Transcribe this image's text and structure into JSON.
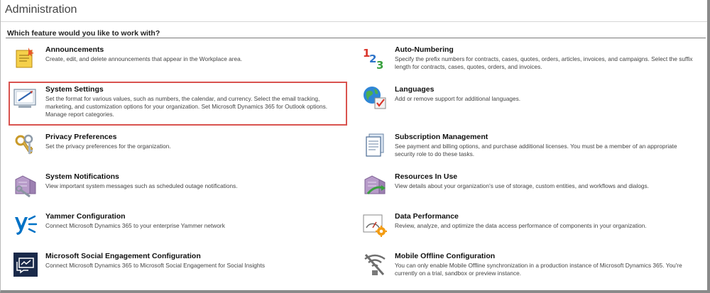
{
  "page": {
    "title": "Administration",
    "question": "Which feature would you like to work with?"
  },
  "features": {
    "announcements": {
      "title": "Announcements",
      "description": "Create, edit, and delete announcements that appear in the Workplace area.",
      "icon": "announcements-icon"
    },
    "auto_numbering": {
      "title": "Auto-Numbering",
      "description": "Specify the prefix numbers for contracts, cases, quotes, orders, articles, invoices, and campaigns. Select the suffix length for contracts, cases, quotes, orders, and invoices.",
      "icon": "auto-numbering-icon"
    },
    "system_settings": {
      "title": "System Settings",
      "description": "Set the format for various values, such as numbers, the calendar, and currency. Select the email tracking, marketing, and customization options for your organization. Set Microsoft Dynamics 365 for Outlook options. Manage report categories.",
      "icon": "system-settings-icon"
    },
    "languages": {
      "title": "Languages",
      "description": "Add or remove support for additional languages.",
      "icon": "languages-icon"
    },
    "privacy_preferences": {
      "title": "Privacy Preferences",
      "description": "Set the privacy preferences for the organization.",
      "icon": "privacy-keys-icon"
    },
    "subscription_management": {
      "title": "Subscription Management",
      "description": "See payment and billing options, and purchase additional licenses. You must be a member of an appropriate security role to do these tasks.",
      "icon": "subscription-document-icon"
    },
    "system_notifications": {
      "title": "System Notifications",
      "description": "View important system messages such as scheduled outage notifications.",
      "icon": "system-notifications-icon"
    },
    "resources_in_use": {
      "title": "Resources In Use",
      "description": "View details about your organization's use of storage, custom entities, and workflows and dialogs.",
      "icon": "resources-in-use-icon"
    },
    "yammer_configuration": {
      "title": "Yammer Configuration",
      "description": "Connect Microsoft Dynamics 365 to your enterprise Yammer network",
      "icon": "yammer-icon"
    },
    "data_performance": {
      "title": "Data Performance",
      "description": "Review, analyze, and optimize the data access performance of components in your organization.",
      "icon": "data-performance-icon"
    },
    "social_engagement": {
      "title": "Microsoft Social Engagement Configuration",
      "description": "Connect Microsoft Dynamics 365 to Microsoft Social Engagement for Social Insights",
      "icon": "social-engagement-icon"
    },
    "mobile_offline": {
      "title": "Mobile Offline Configuration",
      "description": "You can only enable Mobile Offline synchronization in a production instance of Microsoft Dynamics 365. You're currently on a trial, sandbox or preview instance.",
      "icon": "mobile-offline-icon"
    }
  },
  "colors": {
    "highlight_border": "#d9534f",
    "yammer_blue": "#0072c6",
    "social_navy": "#1a2a4a"
  }
}
